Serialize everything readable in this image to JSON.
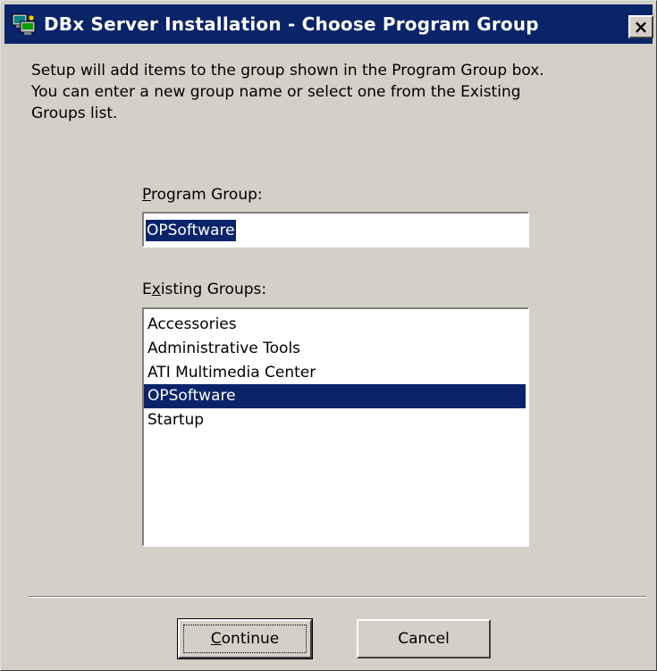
{
  "window": {
    "title": "DBx Server Installation - Choose Program Group",
    "close_label": "×"
  },
  "description": "Setup will add items to the group shown in the Program Group box.\nYou can enter a new group name or select one from the Existing\nGroups list.",
  "program_group": {
    "label_hotkey": "P",
    "label_rest": "rogram Group:",
    "value": "OPSoftware"
  },
  "existing_groups": {
    "label_pre": "E",
    "label_hotkey": "x",
    "label_rest": "isting Groups:",
    "items": [
      "Accessories",
      "Administrative Tools",
      "ATI Multimedia Center",
      "OPSoftware",
      "Startup"
    ],
    "selected": "OPSoftware"
  },
  "buttons": {
    "continue_hotkey": "C",
    "continue_rest": "ontinue",
    "cancel": "Cancel"
  },
  "colors": {
    "titlebar": "#0a246a",
    "face": "#d4d0c8",
    "selection": "#0a246a"
  }
}
